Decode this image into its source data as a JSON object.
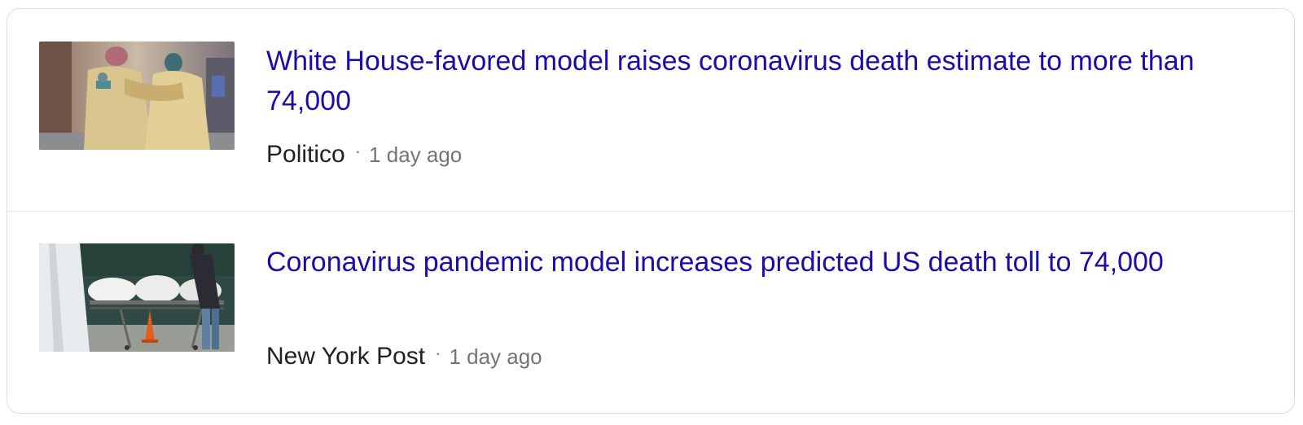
{
  "news": {
    "items": [
      {
        "headline": "White House-favored model raises coronavirus death estimate to more than 74,000",
        "source": "Politico",
        "separator": "·",
        "time": "1 day ago"
      },
      {
        "headline": "Coronavirus pandemic model increases predicted US death toll to 74,000",
        "source": "New York Post",
        "separator": "·",
        "time": "1 day ago"
      }
    ]
  },
  "colors": {
    "headline": "#1a0dab",
    "source": "#202124",
    "meta": "#70757a",
    "border": "#dadce0"
  }
}
